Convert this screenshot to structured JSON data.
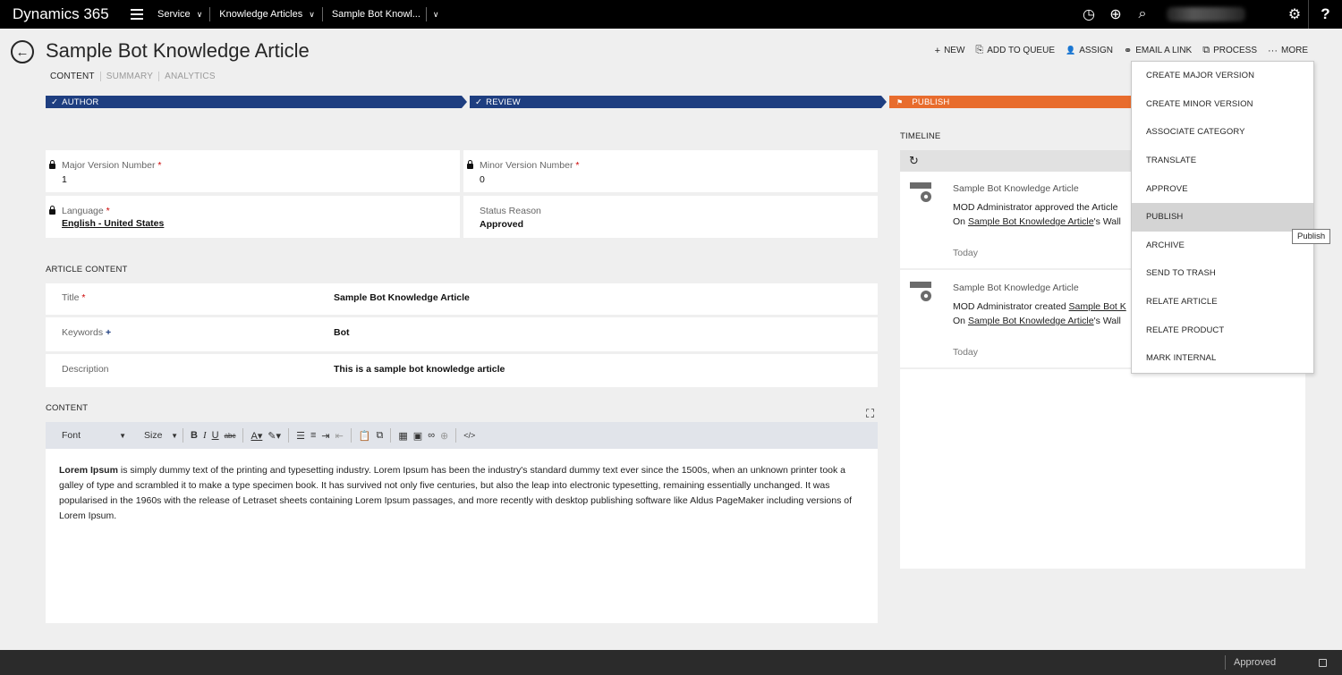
{
  "nav": {
    "brand": "Dynamics 365",
    "crumbs": [
      "Service",
      "Knowledge Articles",
      "Sample Bot Knowl..."
    ],
    "icons": [
      "history-icon",
      "plus-circle-icon",
      "search-icon",
      "gear-icon"
    ],
    "help": "?"
  },
  "header": {
    "title": "Sample Bot Knowledge Article",
    "tabs": [
      "CONTENT",
      "SUMMARY",
      "ANALYTICS"
    ]
  },
  "commands": [
    {
      "label": "NEW",
      "icon": "+"
    },
    {
      "label": "ADD TO QUEUE",
      "icon": "⎘"
    },
    {
      "label": "ASSIGN",
      "icon": "👤"
    },
    {
      "label": "EMAIL A LINK",
      "icon": "⚭"
    },
    {
      "label": "PROCESS",
      "icon": "⧉"
    },
    {
      "label": "MORE",
      "icon": "···"
    }
  ],
  "process": {
    "stages": [
      "AUTHOR",
      "REVIEW",
      "PUBLISH"
    ],
    "colors": {
      "done": "#1e3e80",
      "active": "#e86c2d"
    }
  },
  "fields": {
    "major_label": "Major Version Number",
    "major_value": "1",
    "minor_label": "Minor Version Number",
    "minor_value": "0",
    "language_label": "Language",
    "language_value": "English - United States",
    "status_label": "Status Reason",
    "status_value": "Approved",
    "required_mark": "*",
    "recommended_mark": "+"
  },
  "article": {
    "section": "ARTICLE CONTENT",
    "title_label": "Title",
    "title_value": "Sample Bot Knowledge Article",
    "keywords_label": "Keywords",
    "keywords_value": "Bot",
    "description_label": "Description",
    "description_value": "This is a sample bot knowledge article"
  },
  "content": {
    "section": "CONTENT",
    "font_label": "Font",
    "size_label": "Size",
    "lead": "Lorem Ipsum",
    "body": " is simply dummy text of the printing and typesetting industry. Lorem Ipsum has been the industry's standard dummy text ever since the 1500s, when an unknown printer took a galley of type and scrambled it to make a type specimen book. It has survived not only five centuries, but also the leap into electronic typesetting, remaining essentially unchanged. It was popularised in the 1960s with the release of Letraset sheets containing Lorem Ipsum passages, and more recently with desktop publishing software like Aldus PageMaker including versions of Lorem Ipsum."
  },
  "timeline": {
    "section": "TIMELINE",
    "posts": [
      {
        "title": "Sample Bot Knowledge Article",
        "line1_pre": "MOD Administrator approved the Article",
        "line1_link": "",
        "line2_pre": "On ",
        "line2_link": "Sample Bot Knowledge Article",
        "line2_post": "'s Wall",
        "date": "Today"
      },
      {
        "title": "Sample Bot Knowledge Article",
        "line1_pre": "MOD Administrator created ",
        "line1_link": "Sample Bot K",
        "line2_pre": "On ",
        "line2_link": "Sample Bot Knowledge Article",
        "line2_post": "'s Wall",
        "date": "Today"
      }
    ]
  },
  "menu": {
    "items": [
      "CREATE MAJOR VERSION",
      "CREATE MINOR VERSION",
      "ASSOCIATE CATEGORY",
      "TRANSLATE",
      "APPROVE",
      "PUBLISH",
      "ARCHIVE",
      "SEND TO TRASH",
      "RELATE ARTICLE",
      "RELATE PRODUCT",
      "MARK INTERNAL"
    ],
    "highlighted": "PUBLISH",
    "tooltip": "Publish"
  },
  "footer": {
    "status": "Approved"
  }
}
